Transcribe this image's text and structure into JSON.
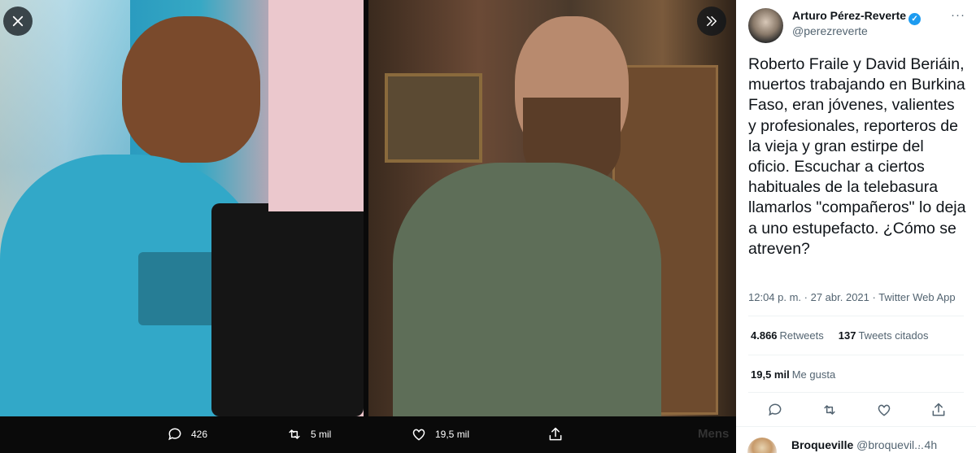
{
  "viewer": {
    "close_icon": "close-icon",
    "expand_icon": "double-chevron-right-icon",
    "actions": {
      "reply_count": "426",
      "retweet_count": "5 mil",
      "like_count": "19,5 mil"
    },
    "background_text": "Mens"
  },
  "tweet": {
    "author_name": "Arturo Pérez-Reverte",
    "author_handle": "@perezreverte",
    "text": "Roberto Fraile y David Beriáin, muertos trabajando en Burkina Faso, eran jóvenes, valientes y profesionales, reporteros de la vieja y gran estirpe del oficio. Escuchar a ciertos habituales de la telebasura llamarlos \"compañeros\" lo deja a uno estupefacto. ¿Cómo se atreven?",
    "meta": "12:04 p. m. · 27 abr. 2021 · Twitter Web App",
    "retweets_value": "4.866",
    "retweets_label": "Retweets",
    "quotes_value": "137",
    "quotes_label": "Tweets citados",
    "likes_value": "19,5 mil",
    "likes_label": "Me gusta"
  },
  "reply": {
    "name": "Broqueville",
    "handle": "@broquevil...",
    "time": "· 4h"
  },
  "colors": {
    "accent": "#1d9bf0",
    "text_primary": "#0f1419",
    "text_secondary": "#536471"
  }
}
